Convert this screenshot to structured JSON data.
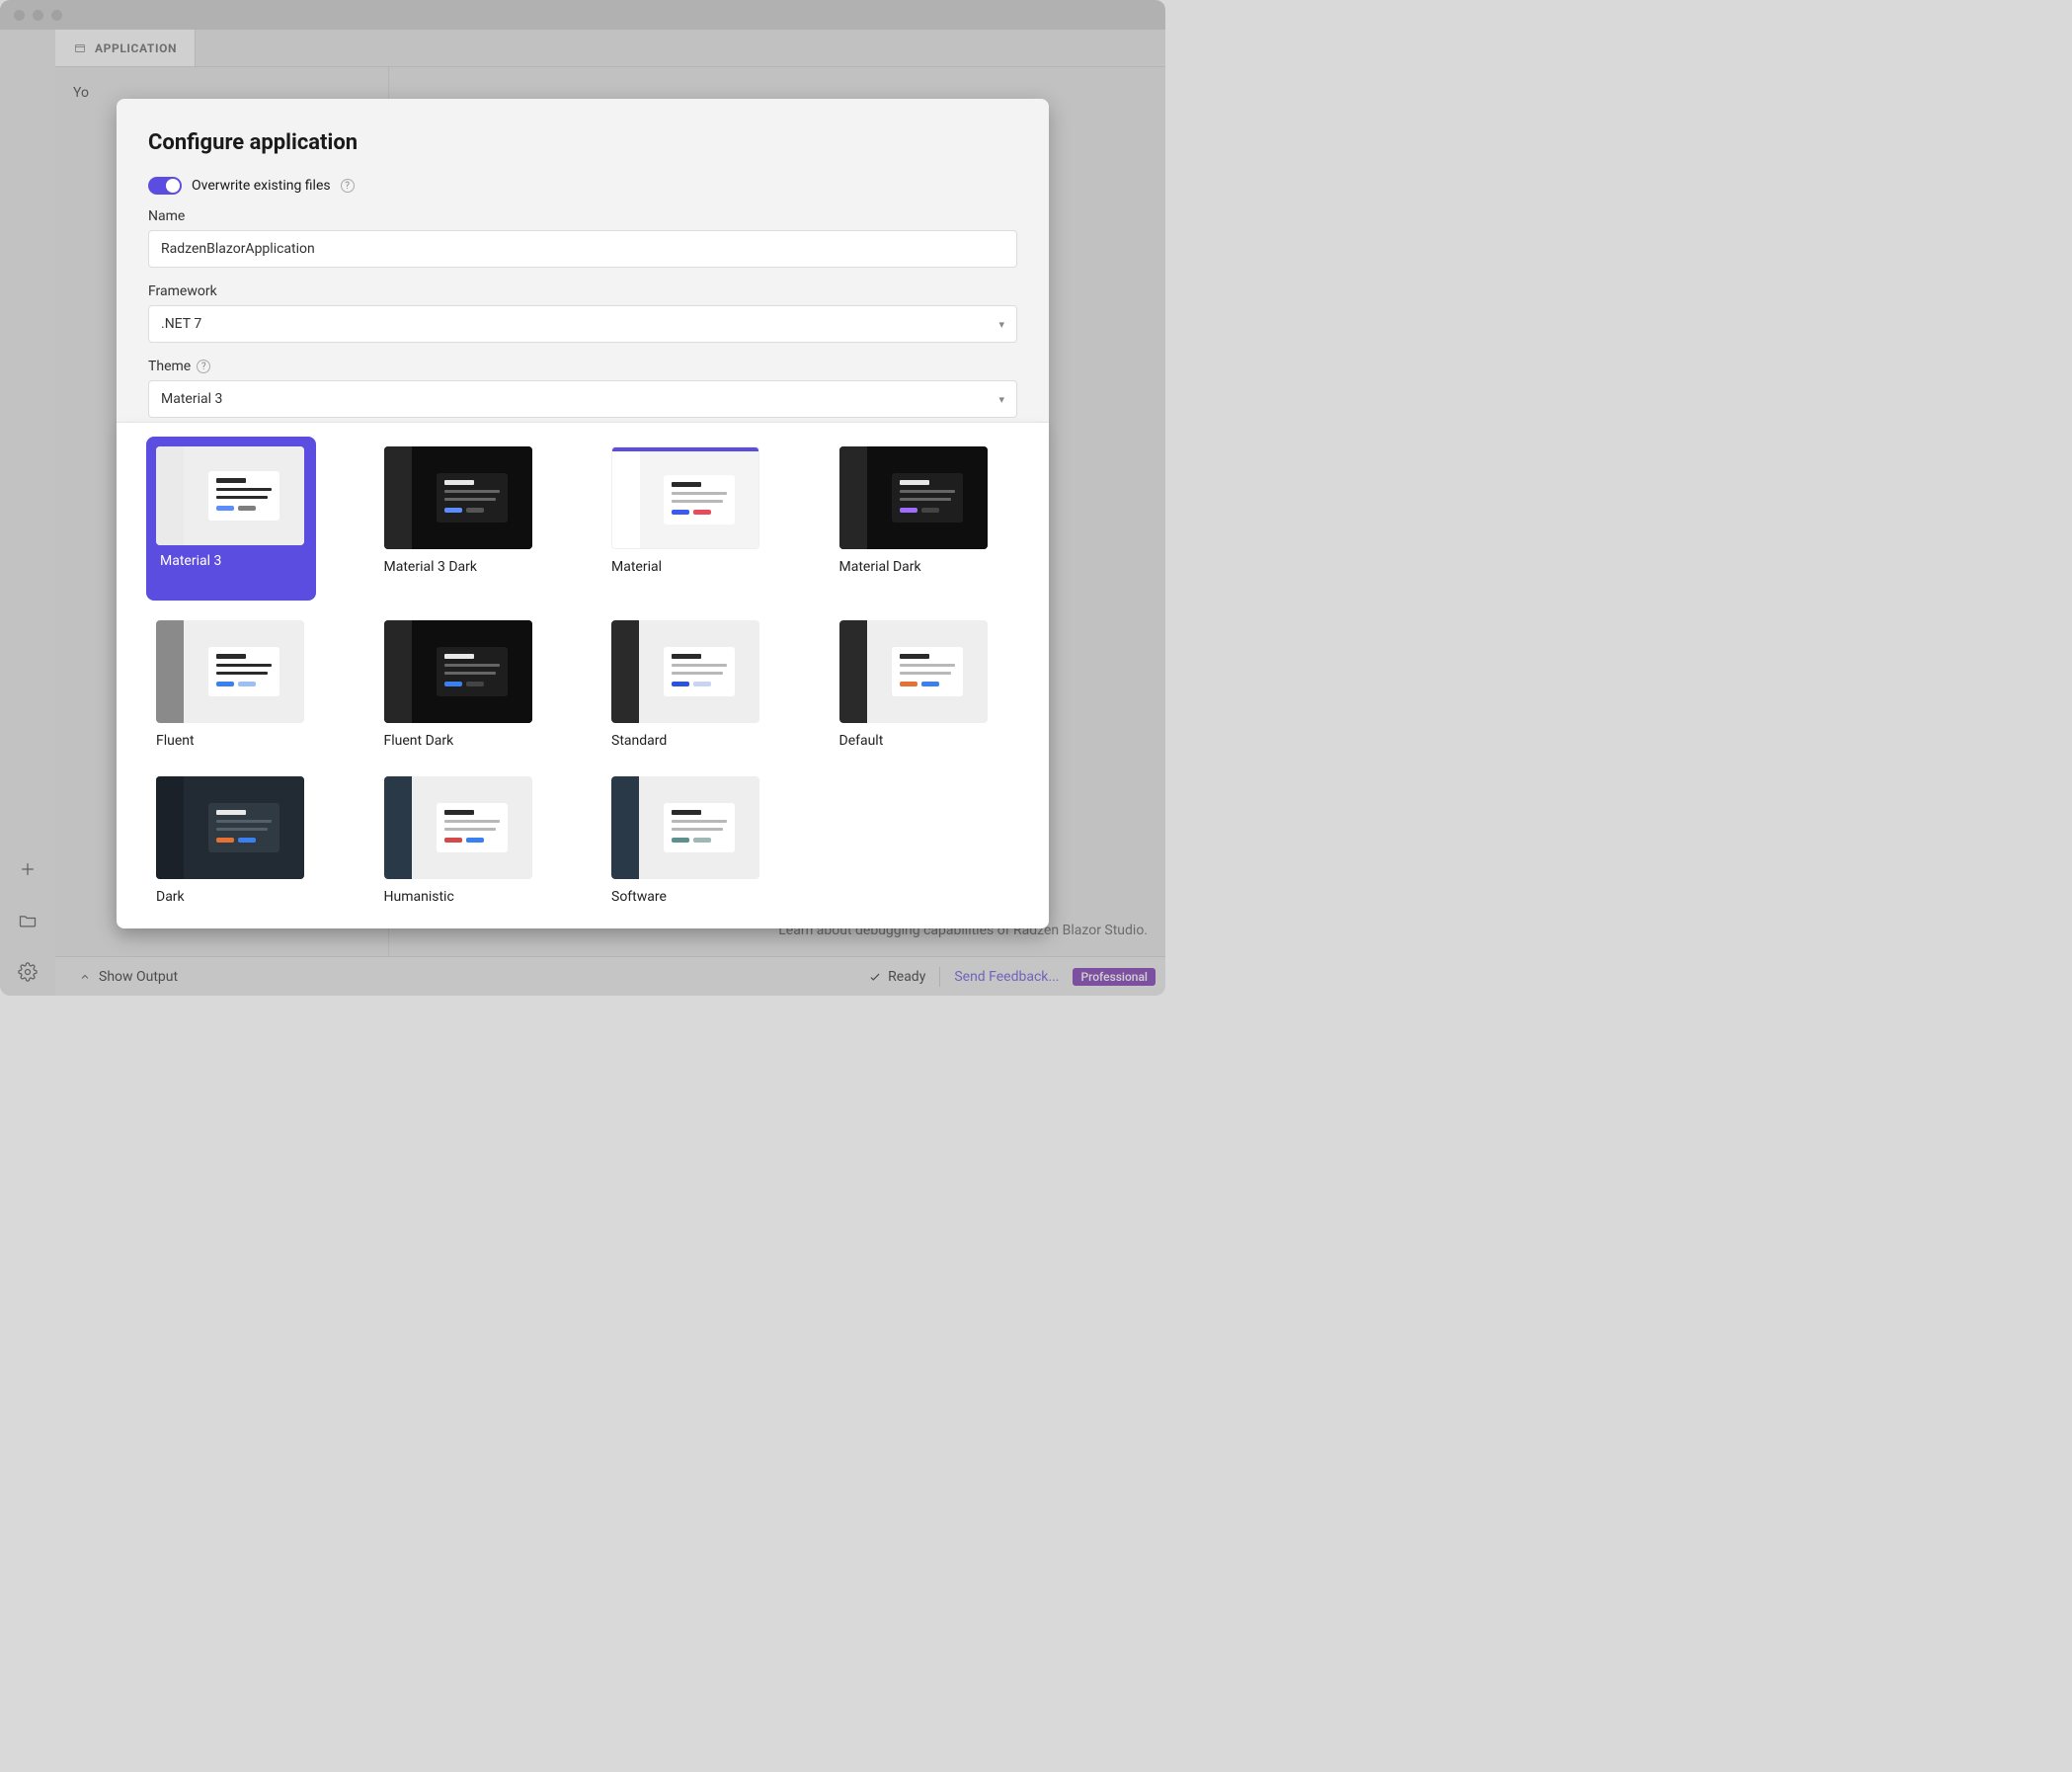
{
  "window": {
    "tab_label": "APPLICATION",
    "left_pane_partial": "Yo",
    "learn_text": "Learn about debugging capabilities of Radzen Blazor Studio."
  },
  "statusbar": {
    "show_output": "Show Output",
    "ready": "Ready",
    "feedback": "Send Feedback...",
    "badge": "Professional"
  },
  "dialog": {
    "title": "Configure application",
    "overwrite_label": "Overwrite existing files",
    "overwrite_on": true,
    "name_label": "Name",
    "name_value": "RadzenBlazorApplication",
    "framework_label": "Framework",
    "framework_value": ".NET 7",
    "theme_label": "Theme",
    "theme_value": "Material 3"
  },
  "themes": [
    {
      "label": "Material 3",
      "selected": true
    },
    {
      "label": "Material 3 Dark"
    },
    {
      "label": "Material"
    },
    {
      "label": "Material Dark"
    },
    {
      "label": "Fluent"
    },
    {
      "label": "Fluent Dark"
    },
    {
      "label": "Standard"
    },
    {
      "label": "Default"
    },
    {
      "label": "Dark"
    },
    {
      "label": "Humanistic"
    },
    {
      "label": "Software"
    }
  ]
}
